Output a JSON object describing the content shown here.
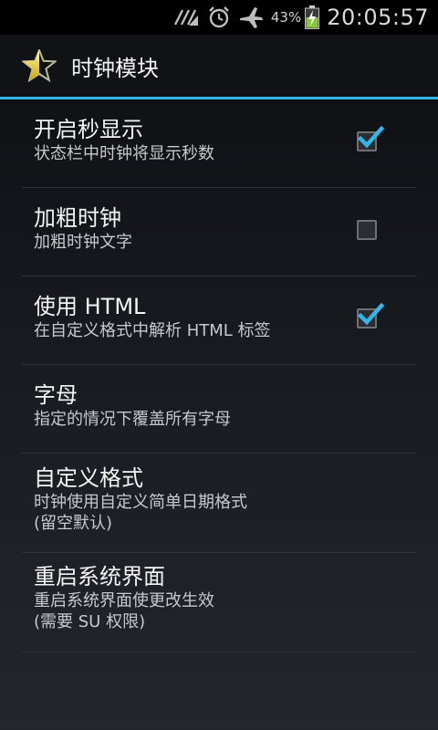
{
  "status_bar": {
    "battery_percent": "43%",
    "time": "20:05:57",
    "icons": [
      "network-icon",
      "alarm-icon",
      "airplane-icon",
      "battery-charging-icon"
    ]
  },
  "action_bar": {
    "title": "时钟模块",
    "icon": "half-star-icon"
  },
  "colors": {
    "accent": "#33b5e5",
    "check": "#33b5e5"
  },
  "preferences": [
    {
      "title": "开启秒显示",
      "summary": "状态栏中时钟将显示秒数",
      "checkbox": true,
      "checked": true
    },
    {
      "title": "加粗时钟",
      "summary": "加粗时钟文字",
      "checkbox": true,
      "checked": false
    },
    {
      "title": "使用 HTML",
      "summary": "在自定义格式中解析 HTML 标签",
      "checkbox": true,
      "checked": true
    },
    {
      "title": "字母",
      "summary": "指定的情况下覆盖所有字母",
      "checkbox": false
    },
    {
      "title": "自定义格式",
      "summary": "时钟使用自定义简单日期格式\n(留空默认)",
      "checkbox": false
    },
    {
      "title": "重启系统界面",
      "summary": "重启系统界面使更改生效\n(需要 SU 权限)",
      "checkbox": false
    }
  ]
}
